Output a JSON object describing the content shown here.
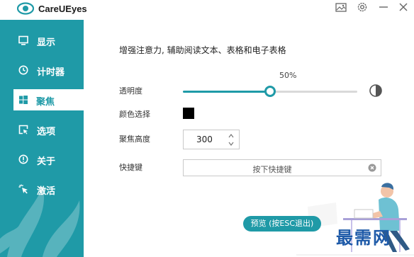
{
  "app": {
    "title": "CareUEyes"
  },
  "sidebar": {
    "items": [
      {
        "label": "显示",
        "icon": "monitor-icon"
      },
      {
        "label": "计时器",
        "icon": "clock-icon"
      },
      {
        "label": "聚焦",
        "icon": "windows-icon",
        "active": true
      },
      {
        "label": "选项",
        "icon": "cursor-box-icon"
      },
      {
        "label": "关于",
        "icon": "info-icon"
      },
      {
        "label": "激活",
        "icon": "sparkle-cursor-icon"
      }
    ]
  },
  "focus": {
    "description": "增强注意力, 辅助阅读文本、表格和电子表格",
    "opacity": {
      "label": "透明度",
      "value_text": "50%",
      "value": 0.5
    },
    "color": {
      "label": "颜色选择",
      "value": "#000000"
    },
    "height": {
      "label": "聚焦高度",
      "value": "300"
    },
    "hotkey": {
      "label": "快捷键",
      "placeholder": "按下快捷键"
    },
    "preview_button": "预览 (按ESC退出)"
  },
  "watermark": "最需网",
  "colors": {
    "accent": "#1f9aa7",
    "sidebar": "#1f9aa7"
  }
}
